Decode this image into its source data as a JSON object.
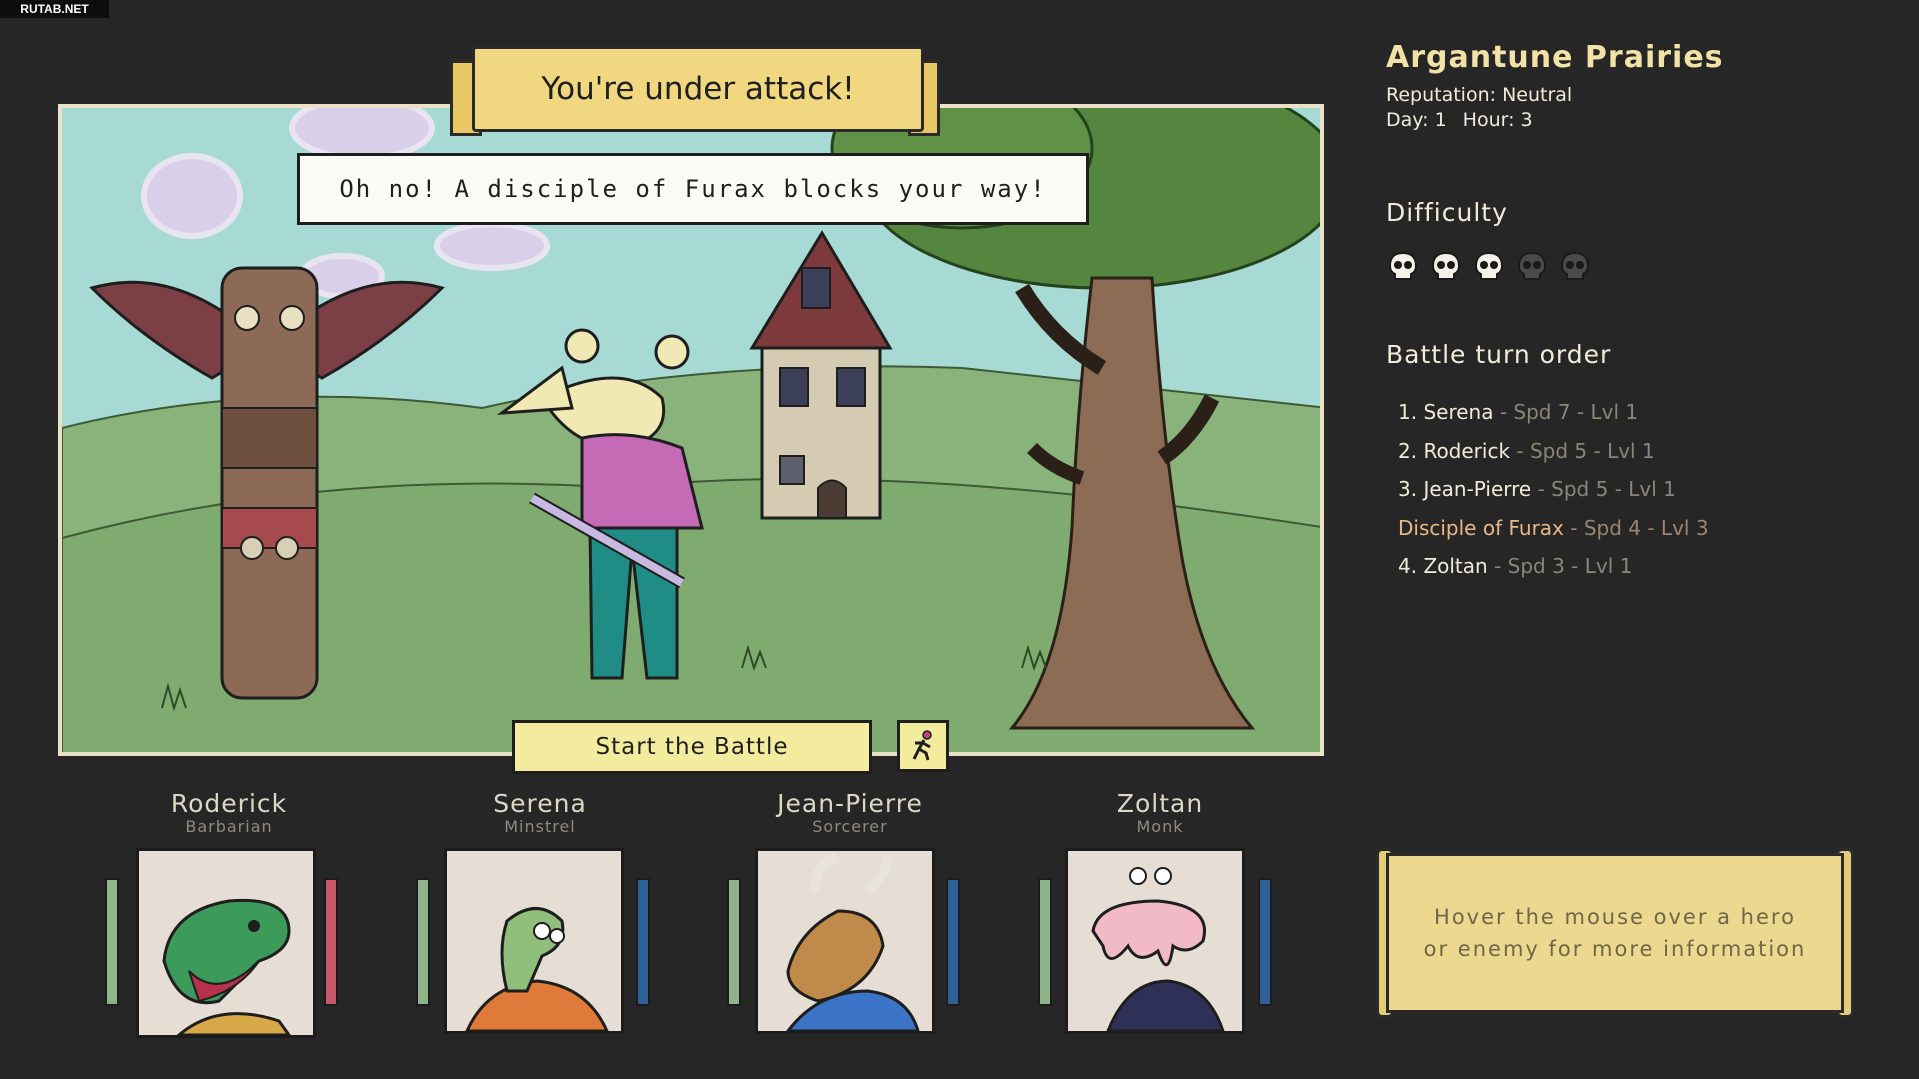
{
  "watermark": "RUTAB.NET",
  "scene": {
    "title": "You're under attack!",
    "message": "Oh no! A disciple of Furax blocks your way!",
    "start_button": "Start the Battle",
    "flee_icon": "running-figure-icon"
  },
  "location": {
    "name": "Argantune Prairies",
    "reputation": "Reputation: Neutral",
    "day": "Day: 1",
    "hour": "Hour: 3"
  },
  "difficulty": {
    "label": "Difficulty",
    "level": 3,
    "max": 5,
    "icon": "skull-icon"
  },
  "turn_order": {
    "label": "Battle turn order",
    "entries": [
      {
        "name": "1. Serena",
        "stats": " - Spd 7 - Lvl 1",
        "enemy": false
      },
      {
        "name": "2. Roderick",
        "stats": " - Spd 5 - Lvl 1",
        "enemy": false
      },
      {
        "name": "3. Jean-Pierre",
        "stats": " - Spd 5 - Lvl 1",
        "enemy": false
      },
      {
        "name": "Disciple of Furax",
        "stats": " - Spd 4 - Lvl 3",
        "enemy": true
      },
      {
        "name": "4. Zoltan",
        "stats": " - Spd 3 - Lvl 1",
        "enemy": false
      }
    ]
  },
  "party": [
    {
      "name": "Roderick",
      "class": "Barbarian",
      "resource_color": "#c9576a",
      "health_color": "#8fb38a"
    },
    {
      "name": "Serena",
      "class": "Minstrel",
      "resource_color": "#2f5f97",
      "health_color": "#8fb38a"
    },
    {
      "name": "Jean-Pierre",
      "class": "Sorcerer",
      "resource_color": "#2f5f97",
      "health_color": "#8fb38a"
    },
    {
      "name": "Zoltan",
      "class": "Monk",
      "resource_color": "#2f5f97",
      "health_color": "#8fb38a"
    }
  ],
  "info_panel": {
    "text": "Hover the mouse over a hero or enemy for more information"
  },
  "colors": {
    "background": "#262626",
    "banner": "#f1d77f",
    "button": "#f3ec9e",
    "enemy_text": "#eab887",
    "region_title": "#f3e2a6"
  }
}
